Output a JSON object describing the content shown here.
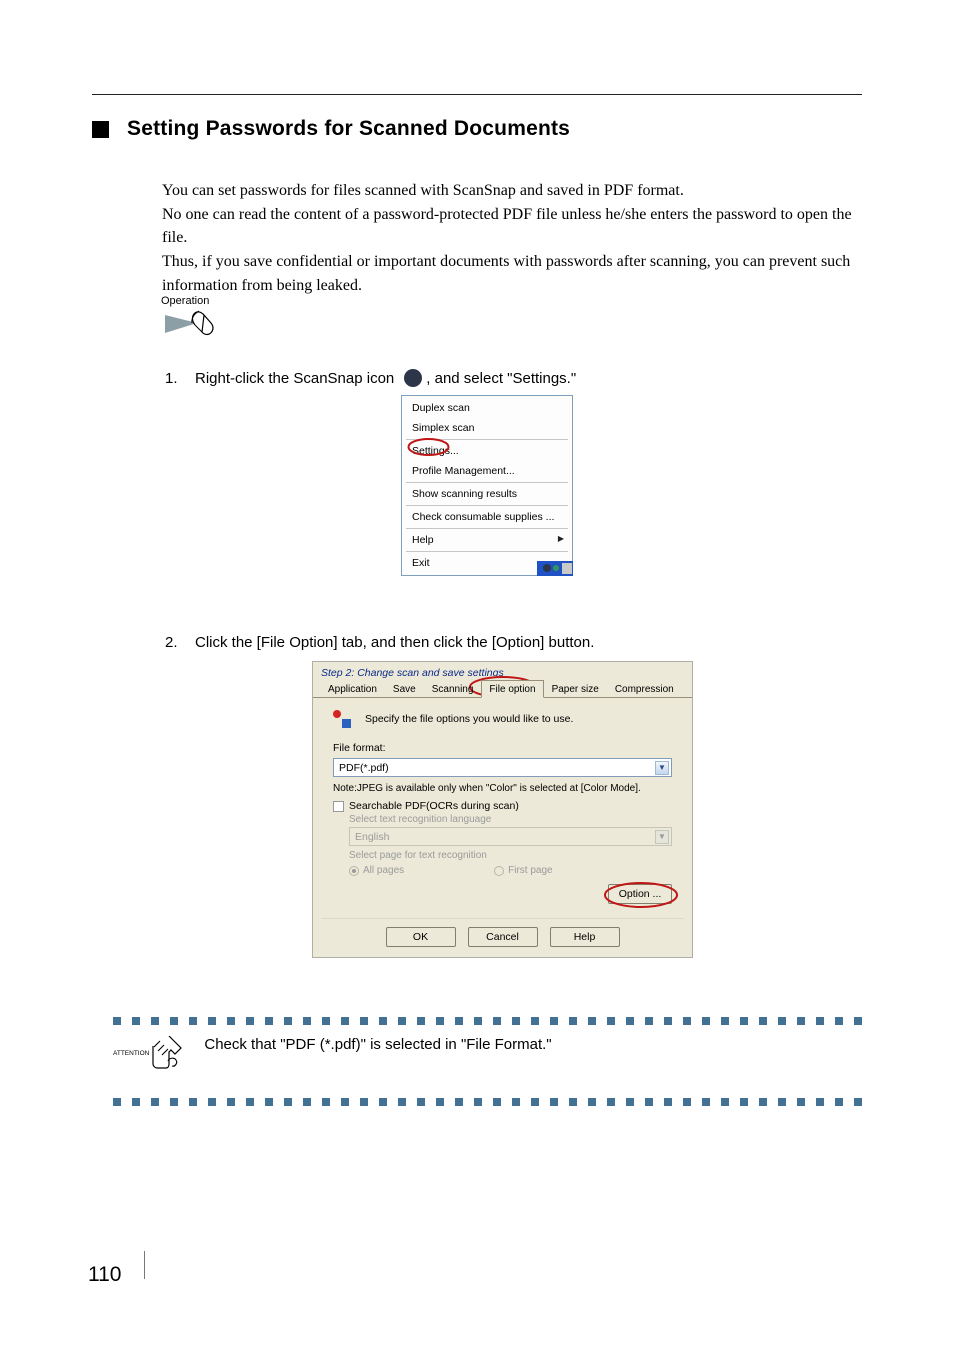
{
  "heading": "Setting Passwords for Scanned Documents",
  "body": "You can set passwords for files scanned with ScanSnap and saved in PDF format.\nNo one can read the content of a password-protected PDF file unless he/she enters the password to open the file.\nThus, if you save confidential or important documents with passwords after scanning, you can prevent such information from being leaked.",
  "operation_label": "Operation",
  "steps": {
    "s1": {
      "num": "1.",
      "pre": "Right-click the ScanSnap icon",
      "post": ", and select \"Settings.\""
    },
    "s2": {
      "num": "2.",
      "text": "Click the [File Option] tab, and then click the [Option] button."
    }
  },
  "context_menu": {
    "items": [
      "Duplex scan",
      "Simplex scan",
      "Settings...",
      "Profile Management...",
      "Show scanning results",
      "Check consumable supplies ...",
      "Help",
      "Exit"
    ]
  },
  "dialog": {
    "step_title": "Step 2: Change scan and save settings",
    "tabs": [
      "Application",
      "Save",
      "Scanning",
      "File option",
      "Paper size",
      "Compression"
    ],
    "spec_line": "Specify the file options you would like to use.",
    "file_format_label": "File format:",
    "file_format_value": "PDF(*.pdf)",
    "note": "Note:JPEG is available only when \"Color\" is selected at [Color Mode].",
    "chk_label": "Searchable PDF(OCRs during scan)",
    "lang_label": "Select text recognition language",
    "lang_value": "English",
    "page_label": "Select page for text recognition",
    "radios": {
      "all": "All pages",
      "first": "First page"
    },
    "option_btn": "Option ...",
    "ok": "OK",
    "cancel": "Cancel",
    "help": "Help"
  },
  "attention": {
    "label": "ATTENTION",
    "text": "Check that \"PDF (*.pdf)\" is selected in \"File Format.\""
  },
  "page_number": "110",
  "icons": {
    "scansnap": "scansnap-tray-icon",
    "operation": "operation-mouse-icon",
    "attention": "attention-hand-icon"
  }
}
